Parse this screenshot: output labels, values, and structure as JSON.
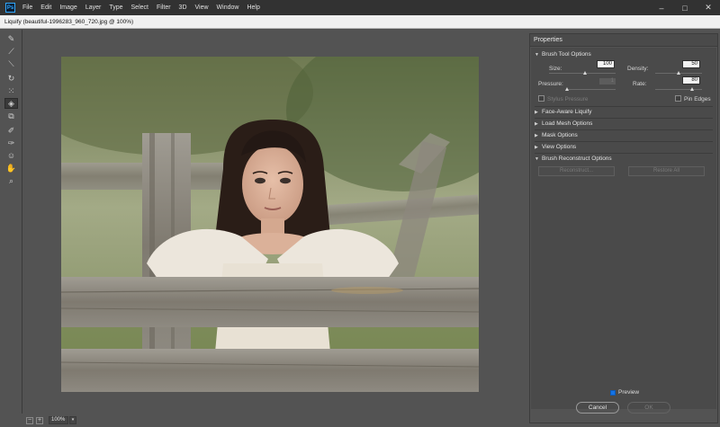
{
  "menubar": {
    "logo": "Ps",
    "items": [
      "File",
      "Edit",
      "Image",
      "Layer",
      "Type",
      "Select",
      "Filter",
      "3D",
      "View",
      "Window",
      "Help"
    ],
    "minimize": "–",
    "maximize": "□",
    "close": "✕"
  },
  "window": {
    "title": "Liquify (beautiful-1996283_960_720.jpg @ 100%)"
  },
  "toolbar": {
    "tools": [
      {
        "icon": "forward-warp-icon",
        "glyph": "✎"
      },
      {
        "icon": "reconstruct-icon",
        "glyph": "⟋"
      },
      {
        "icon": "smooth-icon",
        "glyph": "⟍"
      },
      {
        "icon": "twirl-icon",
        "glyph": "↻"
      },
      {
        "icon": "pucker-icon",
        "glyph": "⁙"
      },
      {
        "icon": "bloat-icon",
        "glyph": "◈"
      },
      {
        "icon": "push-left-icon",
        "glyph": "⧉"
      },
      {
        "icon": "freeze-mask-icon",
        "glyph": "✐"
      },
      {
        "icon": "thaw-mask-icon",
        "glyph": "✑"
      },
      {
        "icon": "face-tool-icon",
        "glyph": "☺"
      },
      {
        "icon": "hand-icon",
        "glyph": "✋"
      },
      {
        "icon": "zoom-icon",
        "glyph": "⌕"
      }
    ]
  },
  "statusbar": {
    "minus": "−",
    "plus": "+",
    "zoom": "100%",
    "dropdown": "▾"
  },
  "properties": {
    "title": "Properties",
    "brush_tool_options": {
      "label": "Brush Tool Options",
      "size_label": "Size:",
      "size_value": "100",
      "size_level": 0.55,
      "density_label": "Density:",
      "density_value": "50",
      "density_level": 0.5,
      "pressure_label": "Pressure:",
      "pressure_value": "1",
      "pressure_level": 0.0,
      "rate_label": "Rate:",
      "rate_value": "80",
      "rate_level": 0.8,
      "stylus_label": "Stylus Pressure",
      "pin_edges_label": "Pin Edges"
    },
    "sections": [
      "Face-Aware Liquify",
      "Load Mesh Options",
      "Mask Options",
      "View Options"
    ],
    "reconstruct": {
      "label": "Brush Reconstruct Options",
      "reconstruct_btn": "Reconstruct...",
      "restore_btn": "Restore All"
    },
    "icons": {
      "expanded": "▼",
      "collapsed": "▶"
    }
  },
  "footer": {
    "preview_label": "Preview",
    "cancel_label": "Cancel",
    "ok_label": "OK"
  }
}
